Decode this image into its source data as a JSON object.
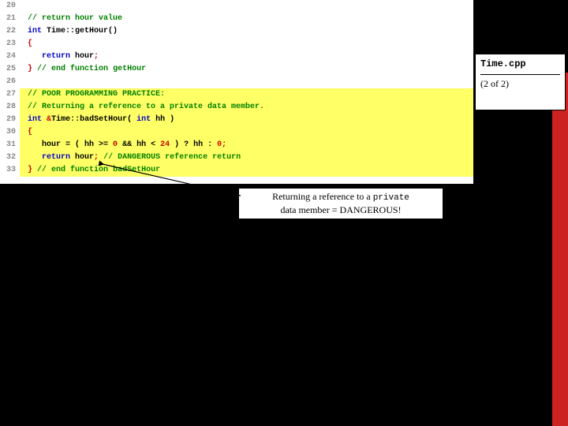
{
  "file_box": {
    "name": "Time.cpp",
    "page": "(2 of 2)"
  },
  "code_lines": [
    {
      "num": "20",
      "hl": false,
      "spans": []
    },
    {
      "num": "21",
      "hl": false,
      "spans": [
        [
          " // return hour value",
          "tok-comment"
        ]
      ]
    },
    {
      "num": "22",
      "hl": false,
      "spans": [
        [
          " ",
          ""
        ],
        [
          "int",
          "tok-type"
        ],
        [
          " Time::getHour()",
          "tok-ident"
        ]
      ]
    },
    {
      "num": "23",
      "hl": false,
      "spans": [
        [
          " ",
          ""
        ],
        [
          "{",
          "tok-punct"
        ]
      ]
    },
    {
      "num": "24",
      "hl": false,
      "spans": [
        [
          "    ",
          ""
        ],
        [
          "return",
          "tok-keyword"
        ],
        [
          " hour",
          "tok-ident"
        ],
        [
          ";",
          "tok-punct"
        ]
      ]
    },
    {
      "num": "25",
      "hl": false,
      "spans": [
        [
          " ",
          ""
        ],
        [
          "}",
          "tok-punct"
        ],
        [
          " ",
          ""
        ],
        [
          "// end function getHour",
          "tok-comment"
        ]
      ]
    },
    {
      "num": "26",
      "hl": false,
      "spans": []
    },
    {
      "num": "27",
      "hl": true,
      "spans": [
        [
          " // POOR PROGRAMMING PRACTICE:",
          "tok-comment"
        ]
      ]
    },
    {
      "num": "28",
      "hl": true,
      "spans": [
        [
          " // Returning a reference to a private data member.",
          "tok-comment"
        ]
      ]
    },
    {
      "num": "29",
      "hl": true,
      "spans": [
        [
          " ",
          ""
        ],
        [
          "int",
          "tok-type"
        ],
        [
          " ",
          ""
        ],
        [
          "&",
          "tok-punct"
        ],
        [
          "Time::badSetHour( ",
          "tok-ident"
        ],
        [
          "int",
          "tok-type"
        ],
        [
          " hh )",
          "tok-ident"
        ]
      ]
    },
    {
      "num": "30",
      "hl": true,
      "spans": [
        [
          " ",
          ""
        ],
        [
          "{",
          "tok-punct"
        ]
      ]
    },
    {
      "num": "31",
      "hl": true,
      "spans": [
        [
          "    hour = ( hh >= ",
          "tok-ident"
        ],
        [
          "0",
          "tok-num"
        ],
        [
          " ",
          ""
        ],
        [
          "&&",
          "tok-op"
        ],
        [
          " hh < ",
          "tok-ident"
        ],
        [
          "24",
          "tok-num"
        ],
        [
          " ) ? hh : ",
          "tok-ident"
        ],
        [
          "0",
          "tok-num"
        ],
        [
          ";",
          "tok-punct"
        ]
      ]
    },
    {
      "num": "32",
      "hl": true,
      "spans": [
        [
          "    ",
          ""
        ],
        [
          "return",
          "tok-keyword"
        ],
        [
          " hour",
          "tok-ident"
        ],
        [
          ";",
          "tok-punct"
        ],
        [
          " ",
          ""
        ],
        [
          "// DANGEROUS reference return",
          "tok-comment"
        ]
      ]
    },
    {
      "num": "33",
      "hl": true,
      "spans": [
        [
          " ",
          ""
        ],
        [
          "}",
          "tok-punct"
        ],
        [
          " ",
          ""
        ],
        [
          "// end function badSetHour",
          "tok-comment"
        ]
      ]
    }
  ],
  "annotation": {
    "line1_prefix": "Returning a reference to a ",
    "line1_mono": "private",
    "line2": "data member = DANGEROUS!"
  }
}
